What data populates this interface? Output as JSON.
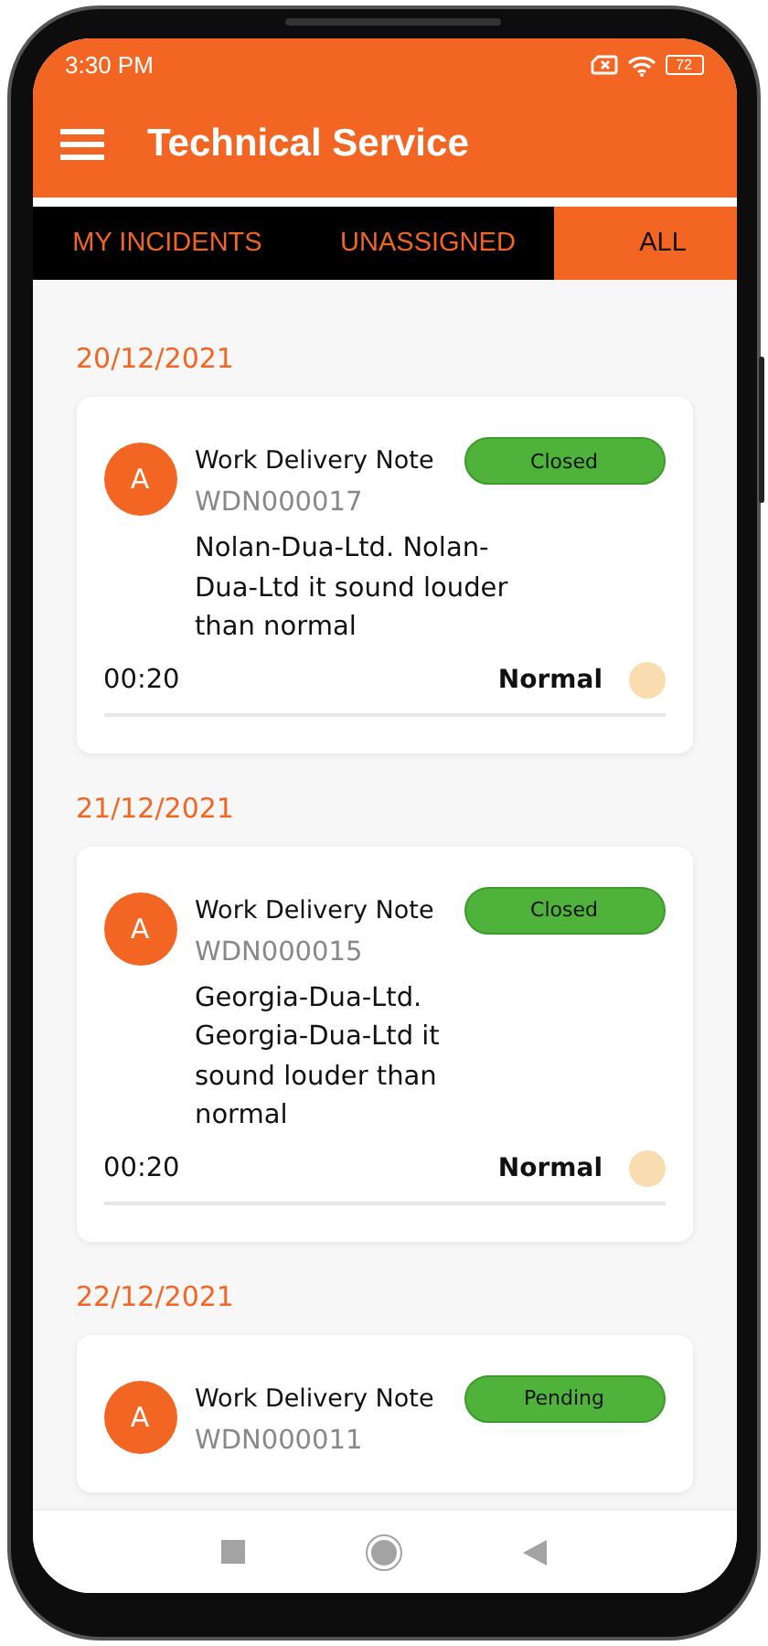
{
  "status_bar": {
    "time": "3:30 PM",
    "battery": "72"
  },
  "app_bar": {
    "title": "Technical Service"
  },
  "tabs": [
    {
      "label": "MY INCIDENTS",
      "selected": false
    },
    {
      "label": "UNASSIGNED",
      "selected": false
    },
    {
      "label": "ALL",
      "selected": true
    }
  ],
  "groups": [
    {
      "date": "20/12/2021",
      "card": {
        "avatar": "A",
        "type": "Work Delivery Note",
        "status": "Closed",
        "number": "WDN000017",
        "description": "Nolan-Dua-Ltd. Nolan-Dua-Ltd it sound louder than normal",
        "time": "00:20",
        "priority": "Normal"
      }
    },
    {
      "date": "21/12/2021",
      "card": {
        "avatar": "A",
        "type": "Work Delivery Note",
        "status": "Closed",
        "number": "WDN000015",
        "description": "Georgia-Dua-Ltd. Georgia-Dua-Ltd it sound louder than normal",
        "time": "00:20",
        "priority": "Normal"
      }
    },
    {
      "date": "22/12/2021",
      "card": {
        "avatar": "A",
        "type": "Work Delivery Note",
        "status": "Pending",
        "number": "WDN000011"
      }
    }
  ]
}
